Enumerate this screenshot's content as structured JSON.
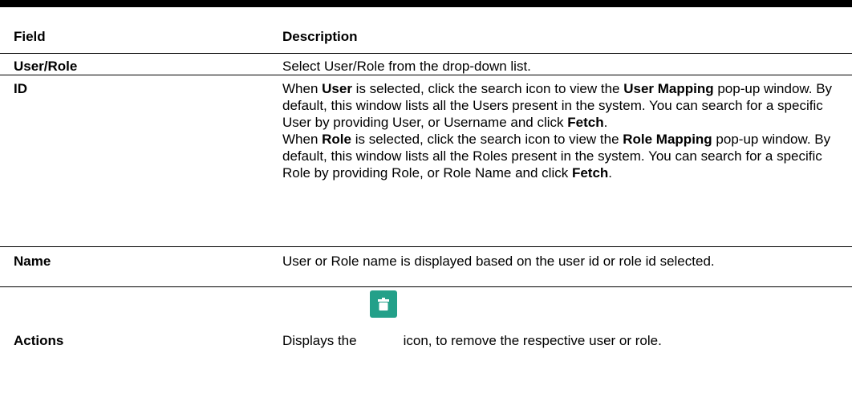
{
  "table": {
    "headers": {
      "field": "Field",
      "description": "Description"
    },
    "rows": {
      "user_role": {
        "field": "User/Role",
        "description": "Select User/Role from the drop-down list."
      },
      "id": {
        "field": "ID",
        "p1": {
          "t1": "When ",
          "b1": "User",
          "t2": " is selected, click the search icon to view the ",
          "b2": "User Mapping",
          "t3": " pop-up window. By default, this window lists all the Users present in the system. You can search for a specific User by providing User, or Username and click ",
          "b3": "Fetch",
          "t4": "."
        },
        "p2": {
          "t1": "When ",
          "b1": "Role",
          "t2": " is selected, click the search icon to view the ",
          "b2": "Role Mapping",
          "t3": " pop-up window. By default, this window lists all the Roles present in the system. You can search for a specific Role by providing Role, or Role Name and click ",
          "b3": "Fetch",
          "t4": "."
        }
      },
      "name": {
        "field": "Name",
        "description": "User or Role name is displayed based on the user id or role id selected."
      },
      "actions": {
        "field": "Actions",
        "desc_before": "Displays the",
        "icon": "trash-icon",
        "desc_after": "icon, to remove the respective user or role."
      }
    }
  },
  "colors": {
    "icon_bg": "#23a089",
    "rule": "#000000"
  }
}
